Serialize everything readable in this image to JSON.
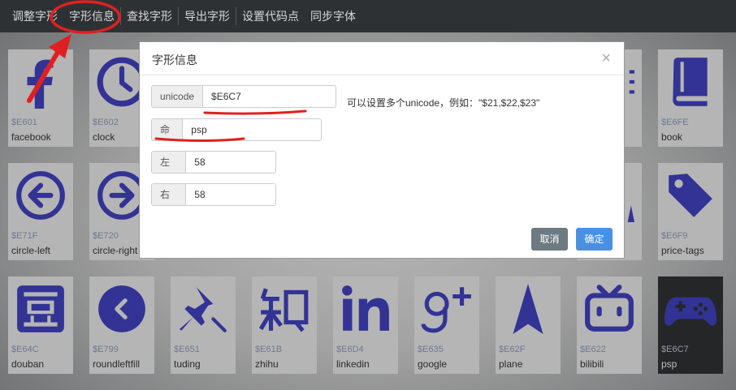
{
  "menu": [
    "调整字形",
    "字形信息",
    "查找字形",
    "导出字形",
    "设置代码点",
    "同步字体"
  ],
  "glyphs": [
    {
      "code": "$E601",
      "name": "facebook",
      "icon": "facebook-icon"
    },
    {
      "code": "$E602",
      "name": "clock",
      "icon": "clock-icon"
    },
    {
      "code": "$E6FE",
      "name": "book",
      "icon": "book-icon"
    },
    {
      "code": "$E71F",
      "name": "circle-left",
      "icon": "circle-left-icon"
    },
    {
      "code": "$E720",
      "name": "circle-right",
      "icon": "circle-right-icon"
    },
    {
      "code": "$E6F9",
      "name": "price-tags",
      "icon": "price-tags-icon"
    },
    {
      "code": "$E64C",
      "name": "douban",
      "icon": "douban-icon"
    },
    {
      "code": "$E799",
      "name": "roundleftfill",
      "icon": "round-left-fill-icon"
    },
    {
      "code": "$E651",
      "name": "tuding",
      "icon": "pin-icon"
    },
    {
      "code": "$E61B",
      "name": "zhihu",
      "icon": "zhihu-icon"
    },
    {
      "code": "$E6D4",
      "name": "linkedin",
      "icon": "linkedin-icon"
    },
    {
      "code": "$E635",
      "name": "google",
      "icon": "google-plus-icon"
    },
    {
      "code": "$E62F",
      "name": "plane",
      "icon": "plane-icon"
    },
    {
      "code": "$E622",
      "name": "bilibili",
      "icon": "bilibili-icon"
    },
    {
      "code": "$E6C7",
      "name": "psp",
      "icon": "gamepad-icon",
      "selected": true
    }
  ],
  "glyph_color": "#3d3fc7",
  "dialog": {
    "title": "字形信息",
    "close": "×",
    "unicode_label": "unicode",
    "unicode_value": "$E6C7",
    "hint": "可以设置多个unicode，例如：\"$21,$22,$23\"",
    "name_label": "命名",
    "name_value": "psp",
    "left_label": "左边距",
    "left_value": "58",
    "right_label": "右边距",
    "right_value": "58",
    "cancel": "取消",
    "ok": "确定"
  },
  "annotation_color": "#e02020"
}
